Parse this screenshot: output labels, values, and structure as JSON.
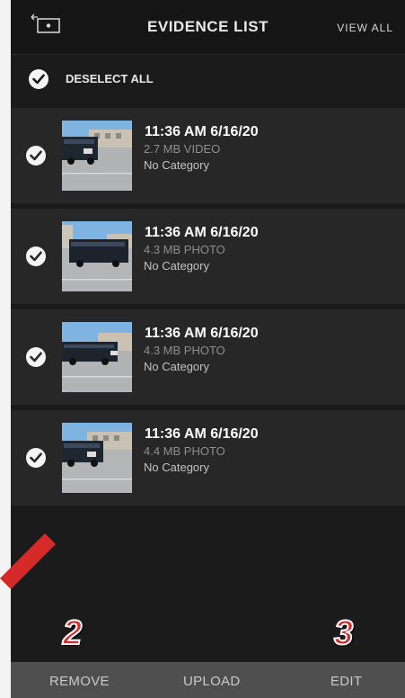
{
  "header": {
    "title": "EVIDENCE LIST",
    "view_all": "VIEW ALL",
    "back_icon": "back-camera-icon"
  },
  "select_all": {
    "label": "DESELECT ALL",
    "checked": true
  },
  "items": [
    {
      "time": "11:36 AM 6/16/20",
      "meta": "2.7 MB VIDEO",
      "category": "No Category",
      "checked": true
    },
    {
      "time": "11:36 AM 6/16/20",
      "meta": "4.3 MB PHOTO",
      "category": "No Category",
      "checked": true
    },
    {
      "time": "11:36 AM 6/16/20",
      "meta": "4.3 MB PHOTO",
      "category": "No Category",
      "checked": true
    },
    {
      "time": "11:36 AM 6/16/20",
      "meta": "4.4 MB PHOTO",
      "category": "No Category",
      "checked": true
    }
  ],
  "annotations": {
    "num_left": "2",
    "num_right": "3"
  },
  "toolbar": {
    "remove": "REMOVE",
    "upload": "UPLOAD",
    "edit": "EDIT"
  },
  "colors": {
    "background": "#1b1b1b",
    "row": "#272727",
    "toolbar": "#4f4f4f",
    "annotation_red": "#d62a2a"
  }
}
